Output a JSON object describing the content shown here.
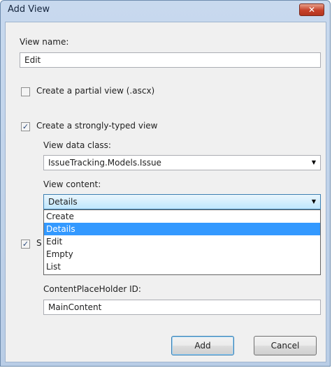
{
  "dialog": {
    "title": "Add View",
    "close_glyph": "✕"
  },
  "view_name": {
    "label": "View name:",
    "value": "Edit"
  },
  "partial_view": {
    "label": "Create a partial view (.ascx)",
    "checked": false
  },
  "strongly_typed": {
    "label": "Create a strongly-typed view",
    "checked": true,
    "check_glyph": "✓"
  },
  "view_data_class": {
    "label": "View data class:",
    "value": "IssueTracking.Models.Issue",
    "arrow": "▼"
  },
  "view_content": {
    "label": "View content:",
    "selected": "Details",
    "arrow": "▼",
    "options": [
      "Create",
      "Details",
      "Edit",
      "Empty",
      "List"
    ],
    "highlighted_index": 1
  },
  "master_page": {
    "label_prefix": "S",
    "checked": true,
    "check_glyph": "✓"
  },
  "content_placeholder": {
    "label": "ContentPlaceHolder ID:",
    "value": "MainContent"
  },
  "buttons": {
    "add": "Add",
    "cancel": "Cancel"
  },
  "colors": {
    "selection": "#3399ff",
    "title_bar": "#c8d9ee",
    "close_button": "#c6412a"
  }
}
